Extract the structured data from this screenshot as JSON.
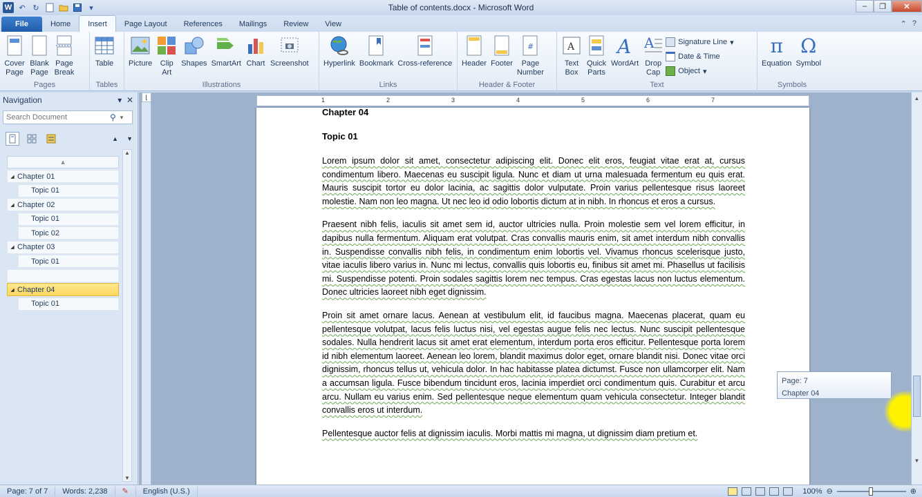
{
  "window": {
    "title": "Table of contents.docx  -  Microsoft Word",
    "logo": "W"
  },
  "tabs": [
    "File",
    "Home",
    "Insert",
    "Page Layout",
    "References",
    "Mailings",
    "Review",
    "View"
  ],
  "active_tab": "Insert",
  "ribbon": {
    "pages": {
      "label": "Pages",
      "cover": "Cover\nPage",
      "blank": "Blank\nPage",
      "break": "Page\nBreak"
    },
    "tables": {
      "label": "Tables",
      "table": "Table"
    },
    "illustrations": {
      "label": "Illustrations",
      "picture": "Picture",
      "clipart": "Clip\nArt",
      "shapes": "Shapes",
      "smartart": "SmartArt",
      "chart": "Chart",
      "screenshot": "Screenshot"
    },
    "links": {
      "label": "Links",
      "hyperlink": "Hyperlink",
      "bookmark": "Bookmark",
      "crossref": "Cross-reference"
    },
    "headerfooter": {
      "label": "Header & Footer",
      "header": "Header",
      "footer": "Footer",
      "pagenumber": "Page\nNumber"
    },
    "text": {
      "label": "Text",
      "textbox": "Text\nBox",
      "quickparts": "Quick\nParts",
      "wordart": "WordArt",
      "dropcap": "Drop\nCap",
      "signature": "Signature Line",
      "datetime": "Date & Time",
      "object": "Object"
    },
    "symbols": {
      "label": "Symbols",
      "equation": "Equation",
      "symbol": "Symbol"
    }
  },
  "navigation": {
    "title": "Navigation",
    "search_placeholder": "Search Document",
    "items": [
      {
        "label": "Chapter 01",
        "level": 1
      },
      {
        "label": "Topic 01",
        "level": 2
      },
      {
        "label": "Chapter 02",
        "level": 1
      },
      {
        "label": "Topic 01",
        "level": 2
      },
      {
        "label": "Topic 02",
        "level": 2
      },
      {
        "label": "Chapter 03",
        "level": 1
      },
      {
        "label": "Topic 01",
        "level": 2
      },
      {
        "label": "",
        "level": 0
      },
      {
        "label": "Chapter 04",
        "level": 1,
        "active": true
      },
      {
        "label": "Topic 01",
        "level": 2
      }
    ]
  },
  "ruler": {
    "numbers": [
      "1",
      "2",
      "3",
      "4",
      "5",
      "6",
      "7"
    ]
  },
  "document": {
    "heading1": "Chapter 04",
    "heading2": "Topic 01",
    "paragraphs": [
      "Lorem ipsum dolor sit amet, consectetur adipiscing elit. Donec elit eros, feugiat vitae erat at, cursus condimentum libero. Maecenas eu suscipit ligula. Nunc et diam ut urna malesuada fermentum eu quis erat. Mauris suscipit tortor eu dolor lacinia, ac sagittis dolor vulputate. Proin varius pellentesque risus laoreet molestie. Nam non leo magna. Ut nec leo id odio lobortis dictum at in nibh. In rhoncus et eros a cursus.",
      "Praesent nibh felis, iaculis sit amet sem id, auctor ultricies nulla. Proin molestie sem vel lorem efficitur, in dapibus nulla fermentum. Aliquam erat volutpat. Cras convallis mauris enim, sit amet interdum nibh convallis in. Suspendisse convallis nibh felis, in condimentum enim lobortis vel. Vivamus rhoncus scelerisque justo, vitae iaculis libero varius in. Nunc mi lectus, convallis quis lobortis eu, finibus sit amet mi. Phasellus ut facilisis mi. Suspendisse potenti. Proin sodales sagittis lorem nec tempus. Cras egestas lacus non luctus elementum. Donec ultricies laoreet nibh eget dignissim.",
      "Proin sit amet ornare lacus. Aenean at vestibulum elit, id faucibus magna. Maecenas placerat, quam eu pellentesque volutpat, lacus felis luctus nisi, vel egestas augue felis nec lectus. Nunc suscipit pellentesque sodales. Nulla hendrerit lacus sit amet erat elementum, interdum porta eros efficitur. Pellentesque porta lorem id nibh elementum laoreet. Aenean leo lorem, blandit maximus dolor eget, ornare blandit nisi. Donec vitae orci dignissim, rhoncus tellus ut, vehicula dolor. In hac habitasse platea dictumst. Fusce non ullamcorper elit. Nam a accumsan ligula. Fusce bibendum tincidunt eros, lacinia imperdiet orci condimentum quis. Curabitur et arcu arcu. Nullam eu varius enim. Sed pellentesque neque elementum quam vehicula consectetur. Integer blandit convallis eros ut interdum.",
      "Pellentesque auctor felis at dignissim iaculis. Morbi mattis mi magna, ut dignissim diam pretium et."
    ]
  },
  "tooltip": {
    "line1": "Page: 7",
    "line2": "Chapter 04"
  },
  "status": {
    "page": "Page: 7 of 7",
    "words": "Words: 2,238",
    "language": "English (U.S.)",
    "zoom": "100%"
  }
}
